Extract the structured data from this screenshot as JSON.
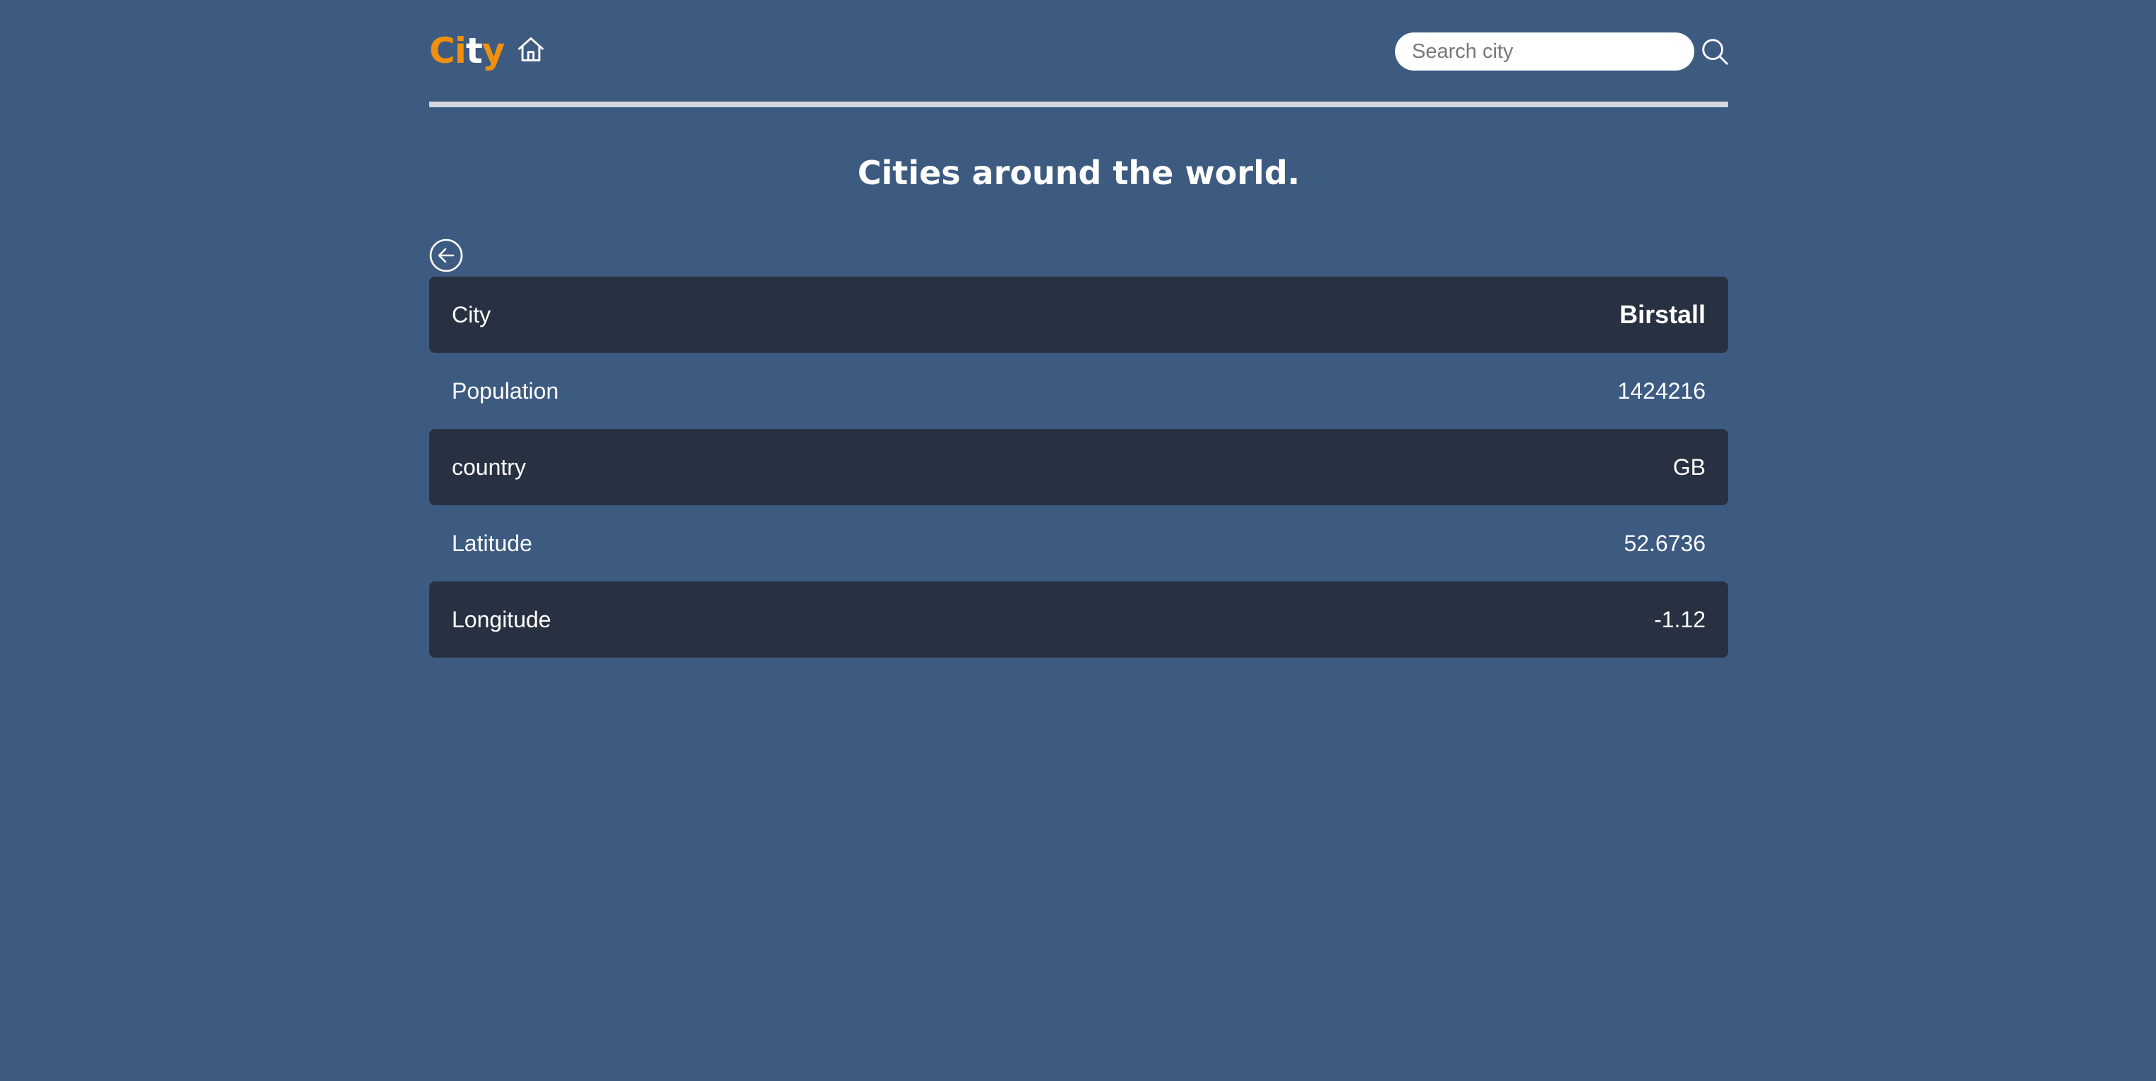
{
  "header": {
    "logo_part1": "Ci",
    "logo_part2": "t",
    "logo_part3": "y",
    "search_placeholder": "Search city",
    "home_icon": "home-icon",
    "search_icon": "search-icon"
  },
  "main": {
    "title": "Cities around the world.",
    "back_icon": "arrow-left-circle-icon",
    "rows": [
      {
        "label": "City",
        "value": "Birstall"
      },
      {
        "label": "Population",
        "value": "1424216"
      },
      {
        "label": "country",
        "value": "GB"
      },
      {
        "label": "Latitude",
        "value": "52.6736"
      },
      {
        "label": "Longitude",
        "value": "-1.12"
      }
    ]
  },
  "colors": {
    "background": "#3d5b81",
    "row_dark": "#283142",
    "accent": "#f0900e"
  }
}
